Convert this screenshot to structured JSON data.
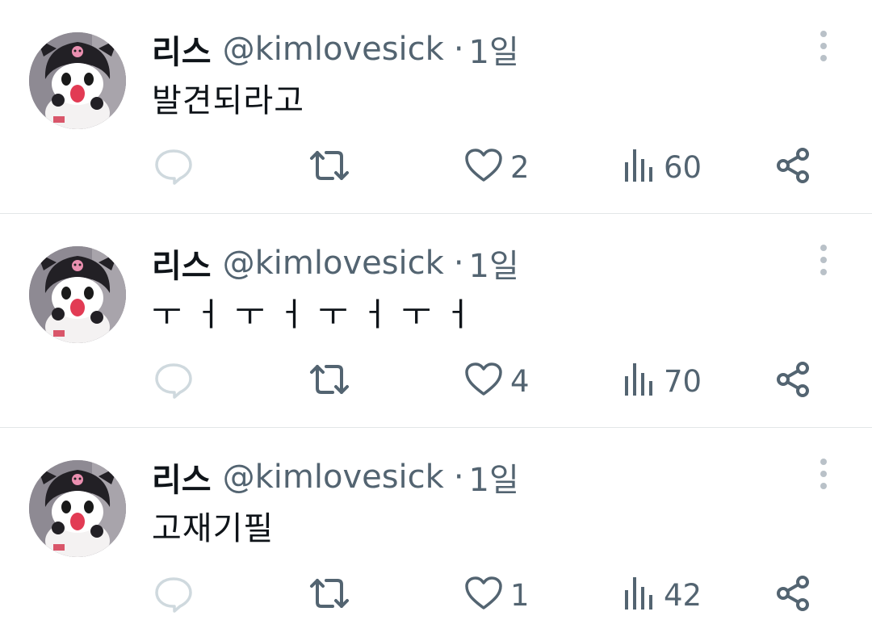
{
  "tweets": [
    {
      "author": {
        "name": "리스",
        "handle": "@kimlovesick"
      },
      "time": "1일",
      "text": "발견되라고",
      "stats": {
        "replies": "",
        "retweets": "",
        "likes": "2",
        "views": "60"
      }
    },
    {
      "author": {
        "name": "리스",
        "handle": "@kimlovesick"
      },
      "time": "1일",
      "text": "ㅜ ㅓ ㅜ ㅓ ㅜ ㅓ ㅜ ㅓ",
      "stats": {
        "replies": "",
        "retweets": "",
        "likes": "4",
        "views": "70"
      }
    },
    {
      "author": {
        "name": "리스",
        "handle": "@kimlovesick"
      },
      "time": "1일",
      "text": "고재기필",
      "stats": {
        "replies": "",
        "retweets": "",
        "likes": "1",
        "views": "42"
      }
    }
  ],
  "separator": "·",
  "icons": {
    "avatar": "kuromi-avatar",
    "more": "more-vertical-icon",
    "reply": "reply-icon",
    "retweet": "retweet-icon",
    "like": "heart-icon",
    "views": "views-chart-icon",
    "share": "share-icon"
  },
  "colors": {
    "text": "#0f1419",
    "secondary": "#536471",
    "divider": "#e3e6e8",
    "icon_light": "#cfd9de"
  }
}
